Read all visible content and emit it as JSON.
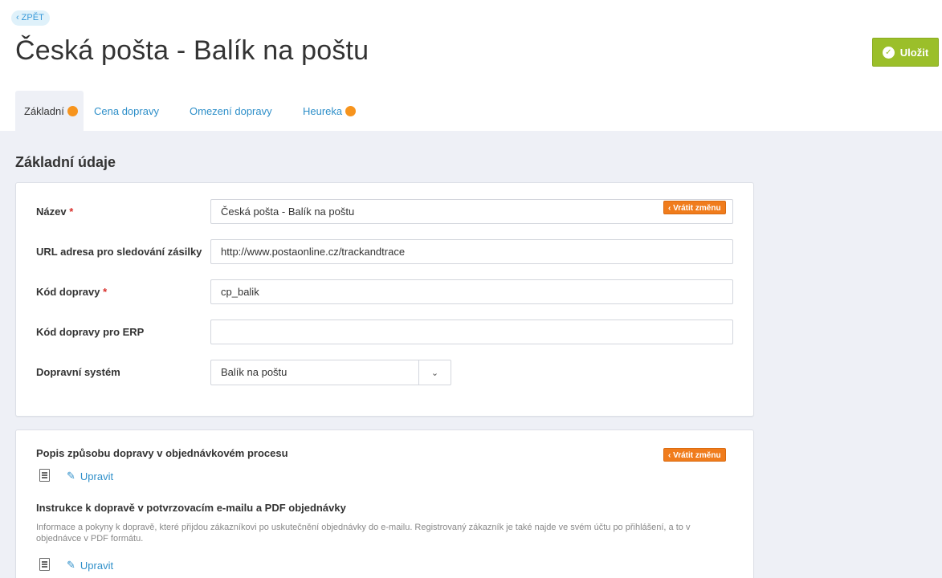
{
  "back": {
    "label": "ZPĚT"
  },
  "title": "Česká pošta - Balík na poštu",
  "save_label": "Uložit",
  "tabs": [
    {
      "label": "Základní",
      "dot": true
    },
    {
      "label": "Cena dopravy",
      "dot": false
    },
    {
      "label": "Omezení dopravy",
      "dot": false
    },
    {
      "label": "Heureka",
      "dot": true
    }
  ],
  "section_title": "Základní údaje",
  "fields": [
    {
      "label": "Název",
      "required": "*",
      "value": "Česká pošta - Balík na poštu"
    },
    {
      "label": "URL adresa pro sledování zásilky",
      "value": "http://www.postaonline.cz/trackandtrace"
    },
    {
      "label": "Kód dopravy",
      "required": "*",
      "value": "cp_balik"
    },
    {
      "label": "Kód dopravy pro ERP",
      "value": ""
    },
    {
      "label": "Dopravní systém",
      "value": "Balík na poštu"
    }
  ],
  "revert_label": "Vrátit změnu",
  "description": {
    "title": "Popis způsobu dopravy v objednávkovém procesu",
    "edit_label": "Upravit"
  },
  "instructions": {
    "title": "Instrukce k dopravě v potvrzovacím e-mailu a PDF objednávky",
    "help": "Informace a pokyny k dopravě, které přijdou zákazníkovi po uskutečnění objednávky do e-mailu. Registrovaný zákazník je také najde ve svém účtu po přihlášení, a to v objednávce v PDF formátu.",
    "edit_label": "Upravit"
  },
  "colors": {
    "accent": "#2e8fc9",
    "save": "#9bbf2a",
    "revert": "#f07c1c",
    "dot": "#f7941d"
  },
  "icons": {
    "back": "chevron-left-icon",
    "save": "check-circle-icon",
    "select": "chevron-down-icon",
    "doc": "document-icon",
    "edit": "pencil-icon"
  }
}
